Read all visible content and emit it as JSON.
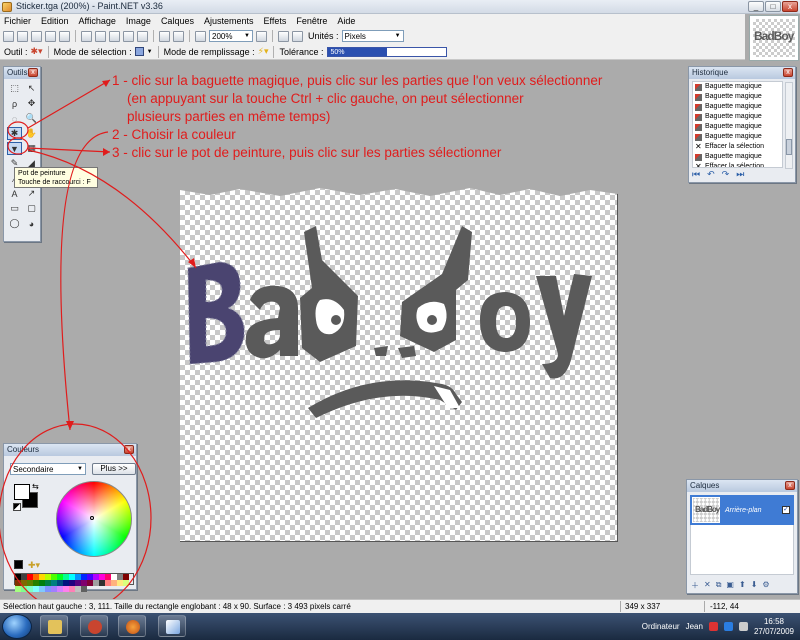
{
  "window": {
    "title": "Sticker.tga (200%) - Paint.NET v3.36",
    "controls": [
      "_",
      "□",
      "x"
    ]
  },
  "menu": [
    "Fichier",
    "Edition",
    "Affichage",
    "Image",
    "Calques",
    "Ajustements",
    "Effets",
    "Fenêtre",
    "Aide"
  ],
  "toolbar1": {
    "zoom_value": "200%",
    "units_label": "Unités :",
    "units_value": "Pixels"
  },
  "toolbar2": {
    "tool_label": "Outil :",
    "selection_mode_label": "Mode de sélection :",
    "fill_mode_label": "Mode de remplissage :",
    "tolerance_label": "Tolérance :",
    "tolerance_value": "50%",
    "tolerance_fraction": 0.5
  },
  "thumbnail": {
    "logo_text": "BadBoy"
  },
  "tools_panel": {
    "title": "Outils",
    "tools": [
      "rectangle-select",
      "move-selection",
      "lasso-select",
      "move-selected",
      "ellipse-select",
      "zoom",
      "magic-wand",
      "pan",
      "paint-bucket",
      "gradient",
      "paintbrush",
      "eraser",
      "pencil",
      "color-picker",
      "text",
      "line-curve",
      "rectangle",
      "rounded-rectangle",
      "ellipse",
      "freeform-shape"
    ],
    "tool_glyphs": [
      "⬚",
      "↖",
      "ρ",
      "✥",
      "◌",
      "🔍",
      "✱",
      "✋",
      "▼",
      "▦",
      "✎",
      "◢",
      "∕",
      "✒",
      "A",
      "↗",
      "▭",
      "▢",
      "◯",
      "◕"
    ],
    "active_tools": [
      6,
      8
    ]
  },
  "tooltip": {
    "line1": "Pot de peinture",
    "line2": "Touche de raccourci : F"
  },
  "history_panel": {
    "title": "Historique",
    "items": [
      {
        "label": "Baguette magique",
        "icon": "magic-wand"
      },
      {
        "label": "Baguette magique",
        "icon": "magic-wand"
      },
      {
        "label": "Baguette magique",
        "icon": "magic-wand"
      },
      {
        "label": "Baguette magique",
        "icon": "magic-wand"
      },
      {
        "label": "Baguette magique",
        "icon": "magic-wand"
      },
      {
        "label": "Baguette magique",
        "icon": "magic-wand"
      },
      {
        "label": "Effacer la sélection",
        "icon": "x"
      },
      {
        "label": "Baguette magique",
        "icon": "magic-wand"
      },
      {
        "label": "Effacer la sélection",
        "icon": "x"
      },
      {
        "label": "Baguette magique",
        "icon": "magic-wand"
      }
    ],
    "footer_icons": [
      "⏮",
      "↶",
      "↷",
      "⏭"
    ]
  },
  "colors_panel": {
    "title": "Couleurs",
    "mode_value": "Secondaire",
    "more_button": "Plus >>",
    "primary_color": "#ffffff",
    "secondary_color": "#000000",
    "palette": [
      "#000000",
      "#404040",
      "#ff0000",
      "#ff6a00",
      "#ffd800",
      "#b6ff00",
      "#4cff00",
      "#00ff21",
      "#00ff90",
      "#00ffff",
      "#0094ff",
      "#0026ff",
      "#4800ff",
      "#b200ff",
      "#ff00dc",
      "#ff006e",
      "#ffffff",
      "#808080",
      "#7f0000",
      "#7f3300",
      "#7f6a00",
      "#5b7f00",
      "#267f00",
      "#007f0e",
      "#007f46",
      "#007f7f",
      "#004a7f",
      "#00137f",
      "#21007f",
      "#57007f",
      "#7f006e",
      "#7f0037",
      "#a0a0a0",
      "#303030",
      "#ff7f7f",
      "#ffb27f",
      "#ffe97f",
      "#daff7f",
      "#a5ff7f",
      "#7fff8e",
      "#7fffc5",
      "#7fffff",
      "#7fc9ff",
      "#7f92ff",
      "#a17fff",
      "#d67fff",
      "#ff7fed",
      "#ff7fb6",
      "#c0c0c0",
      "#606060"
    ]
  },
  "layers_panel": {
    "title": "Calques",
    "layers": [
      {
        "name": "Arrière-plan",
        "visible": true
      }
    ],
    "thumb_text": "BadBoy",
    "footer_icons": [
      "＋",
      "✕",
      "⧉",
      "▣",
      "⬆",
      "⬇",
      "⚙"
    ]
  },
  "annotations": {
    "step1_line1": "1 - clic sur la baguette magique, puis clic sur les parties que l'on veux sélectionner",
    "step1_line2": "(en appuyant sur la touche Ctrl + clic gauche, on peut sélectionner",
    "step1_line3": "plusieurs parties en même temps)",
    "step2": "2 - Choisir la couleur",
    "step3": "3 - clic sur le pot de peinture, puis clic sur les parties sélectionner"
  },
  "statusbar": {
    "selection_info": "Sélection haut gauche : 3, 111. Taille du rectangle englobant : 48 x 90. Surface : 3 493 pixels carré",
    "image_size": "349 x 337",
    "cursor_position": "-112, 44"
  },
  "taskbar": {
    "tray_label_computer": "Ordinateur",
    "tray_label_user": "Jean",
    "time": "16:58",
    "date": "27/07/2009"
  },
  "colors": {
    "annotation_red": "#e01c1c",
    "logo_gray": "#5a5a5a",
    "logo_blue_fill": "#4a4470"
  }
}
